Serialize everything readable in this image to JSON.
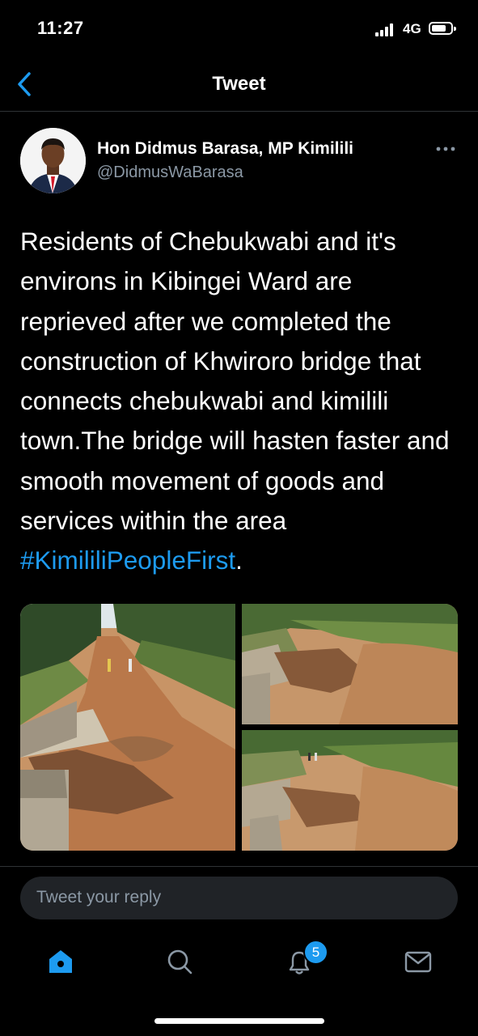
{
  "status_bar": {
    "time": "11:27",
    "network": "4G"
  },
  "nav": {
    "title": "Tweet"
  },
  "tweet": {
    "author_name": "Hon Didmus Barasa, MP Kimilili",
    "author_handle": "@DidmusWaBarasa",
    "text": "Residents of Chebukwabi and it's environs in Kibingei Ward are reprieved after we completed the construction of Khwiroro bridge that connects chebukwabi and kimilili town.The bridge will hasten faster and smooth movement of goods and services within the area ",
    "hashtag": "#KimililiPeopleFirst",
    "text_end": "."
  },
  "reply": {
    "placeholder": "Tweet your reply"
  },
  "tabbar": {
    "items": [
      {
        "icon": "home-icon",
        "active": true
      },
      {
        "icon": "search-icon",
        "active": false
      },
      {
        "icon": "notifications-icon",
        "active": false
      },
      {
        "icon": "messages-icon",
        "active": false
      }
    ],
    "notification_count": "5"
  },
  "colors": {
    "accent": "#1d9bf0",
    "muted": "#8b98a5",
    "background": "#000000"
  }
}
